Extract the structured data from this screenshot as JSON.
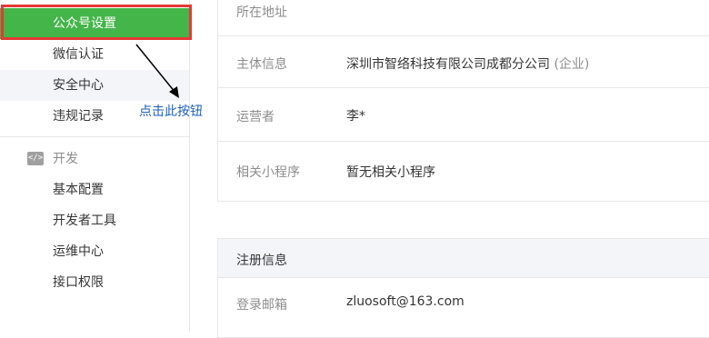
{
  "sidebar": {
    "items": [
      {
        "label": "公众号设置",
        "active": true
      },
      {
        "label": "微信认证"
      },
      {
        "label": "安全中心"
      },
      {
        "label": "违规记录"
      }
    ],
    "dev_group": {
      "icon": "code-icon",
      "icon_text": "</>",
      "label": "开发",
      "items": [
        {
          "label": "基本配置"
        },
        {
          "label": "开发者工具"
        },
        {
          "label": "运维中心"
        },
        {
          "label": "接口权限"
        }
      ]
    },
    "accent_color": "#44b549",
    "highlight_color": "#e53935"
  },
  "annotation": {
    "text": "点击此按钮",
    "color": "#1c5fbd"
  },
  "info_panel": {
    "rows": [
      {
        "label": "所在地址",
        "value": ""
      },
      {
        "label": "主体信息",
        "value": "深圳市智络科技有限公司成都分公司",
        "tag": "(企业)"
      },
      {
        "label": "运营者",
        "value": "李*"
      },
      {
        "label": "相关小程序",
        "value": "暂无相关小程序"
      }
    ]
  },
  "register_panel": {
    "header": "注册信息",
    "rows": [
      {
        "label": "登录邮箱",
        "value": "zluosoft@163.com"
      }
    ]
  }
}
